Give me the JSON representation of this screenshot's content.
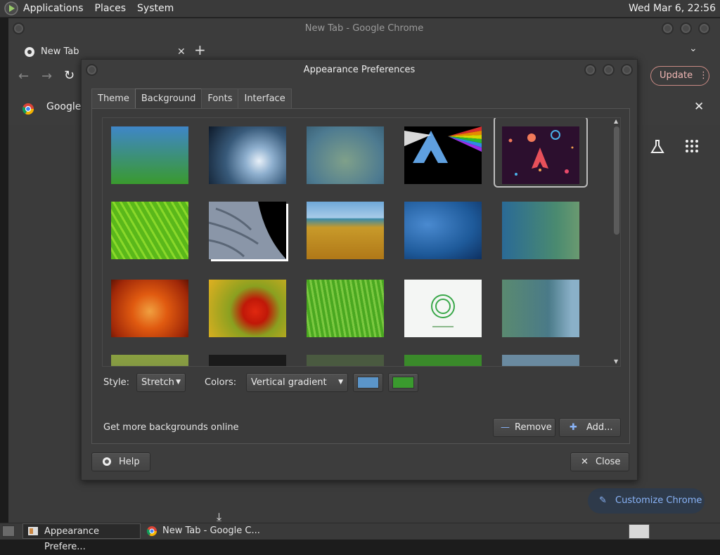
{
  "top_panel": {
    "menus": [
      "Applications",
      "Places",
      "System"
    ],
    "clock": "Wed Mar  6, 22:56"
  },
  "chrome": {
    "window_title": "New Tab - Google Chrome",
    "tab_title": "New Tab",
    "bookmark_label": "Google",
    "update_label": "Update",
    "customize_label": "Customize Chrome"
  },
  "dialog": {
    "title": "Appearance Preferences",
    "tabs": [
      "Theme",
      "Background",
      "Fonts",
      "Interface"
    ],
    "active_tab": "Background",
    "style_label": "Style:",
    "style_value": "Stretch",
    "colors_label": "Colors:",
    "colors_value": "Vertical gradient",
    "color1": "#5b95c9",
    "color2": "#3a9a2e",
    "more_online": "Get more backgrounds online",
    "remove_label": "Remove",
    "add_label": "Add...",
    "help_label": "Help",
    "close_label": "Close",
    "selected_wallpaper": "space-arch"
  },
  "taskbar": {
    "items": [
      "Appearance Prefere...",
      "New Tab - Google C..."
    ]
  },
  "wallpapers": [
    "blue-green-gradient",
    "water-drop",
    "blurred-green",
    "arch-rainbow",
    "space-arch",
    "green-leaf",
    "planet-surface",
    "wheat-field",
    "blue-drops",
    "teal-gradient-dots",
    "orange-flower",
    "red-flower",
    "green-grass",
    "white-logo",
    "blue-wave"
  ]
}
